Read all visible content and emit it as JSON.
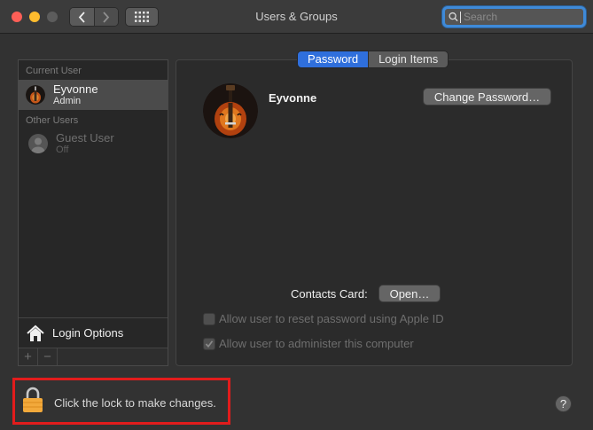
{
  "window": {
    "title": "Users & Groups"
  },
  "search": {
    "placeholder": "Search",
    "value": ""
  },
  "sidebar": {
    "current_user_header": "Current User",
    "current_user": {
      "name": "Eyvonne",
      "role": "Admin",
      "avatar_icon": "guitar-photo"
    },
    "other_users_header": "Other Users",
    "other_users": [
      {
        "name": "Guest User",
        "role": "Off",
        "avatar_icon": "person-silhouette-icon"
      }
    ],
    "login_options_label": "Login Options",
    "add_button": "+",
    "remove_button": "−"
  },
  "tabs": [
    {
      "label": "Password",
      "active": true
    },
    {
      "label": "Login Items",
      "active": false
    }
  ],
  "profile": {
    "name": "Eyvonne",
    "change_password_label": "Change Password…",
    "contacts_card_label": "Contacts Card:",
    "open_label": "Open…"
  },
  "options": [
    {
      "label": "Allow user to reset password using Apple ID",
      "checked": false,
      "enabled": false
    },
    {
      "label": "Allow user to administer this computer",
      "checked": true,
      "enabled": false
    }
  ],
  "footer": {
    "lock_text": "Click the lock to make changes.",
    "help_label": "?"
  },
  "colors": {
    "accent": "#2f6fdc",
    "highlight_box": "#e21c1c",
    "lock": "#f2a93b"
  }
}
